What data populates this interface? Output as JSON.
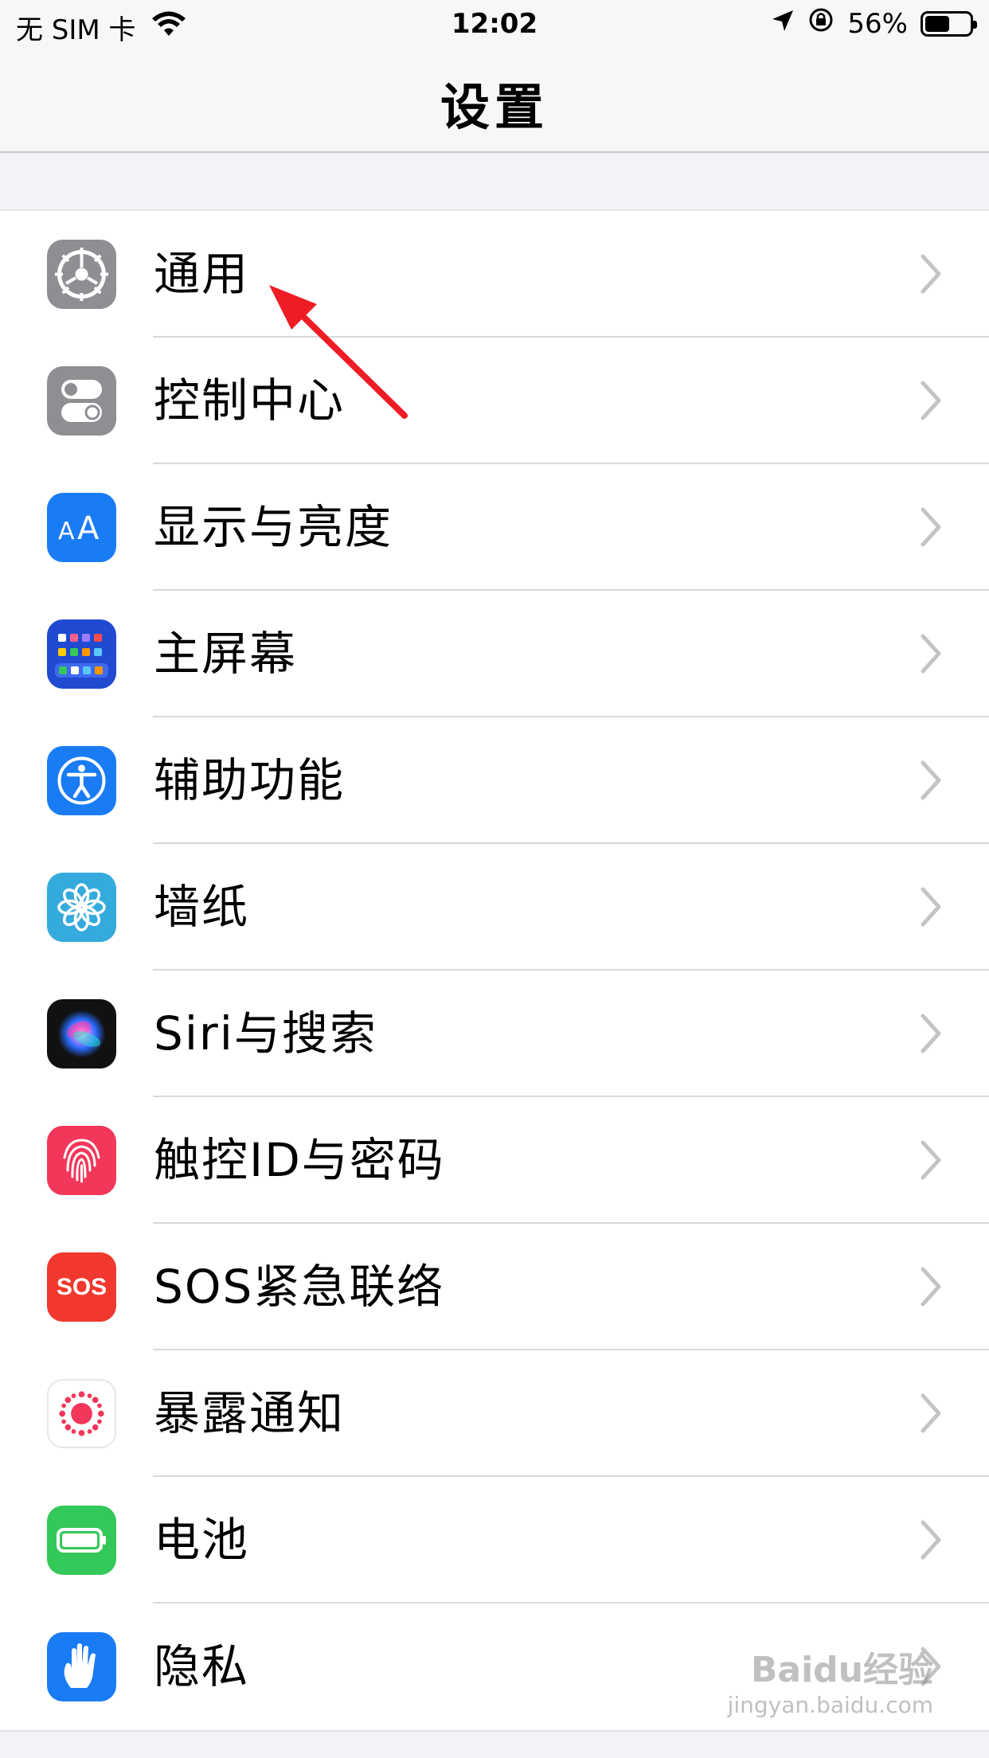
{
  "status_bar": {
    "carrier": "无 SIM 卡",
    "time": "12:02",
    "battery_percent": "56%",
    "battery_level": 0.56
  },
  "nav": {
    "title": "设置"
  },
  "items": [
    {
      "label": "通用",
      "icon": "gear-icon",
      "color": "#8e8e93"
    },
    {
      "label": "控制中心",
      "icon": "toggles-icon",
      "color": "#8e8e93"
    },
    {
      "label": "显示与亮度",
      "icon": "text-size-icon",
      "color": "#1a7cf5"
    },
    {
      "label": "主屏幕",
      "icon": "home-grid-icon",
      "color": "#1f4ad1"
    },
    {
      "label": "辅助功能",
      "icon": "accessibility-icon",
      "color": "#1a7cf5"
    },
    {
      "label": "墙纸",
      "icon": "flower-icon",
      "color": "#35aadc"
    },
    {
      "label": "Siri与搜索",
      "icon": "siri-icon",
      "color": "#1c1c1e"
    },
    {
      "label": "触控ID与密码",
      "icon": "fingerprint-icon",
      "color": "#f2375a"
    },
    {
      "label": "SOS紧急联络",
      "icon": "sos-icon",
      "color": "#f0382f",
      "icon_text": "SOS"
    },
    {
      "label": "暴露通知",
      "icon": "exposure-icon",
      "color": "#ffffff"
    },
    {
      "label": "电池",
      "icon": "battery-icon",
      "color": "#34c759"
    },
    {
      "label": "隐私",
      "icon": "hand-icon",
      "color": "#1a7cf5"
    }
  ],
  "watermark": {
    "brand": "Baidu经验",
    "url": "jingyan.baidu.com"
  }
}
